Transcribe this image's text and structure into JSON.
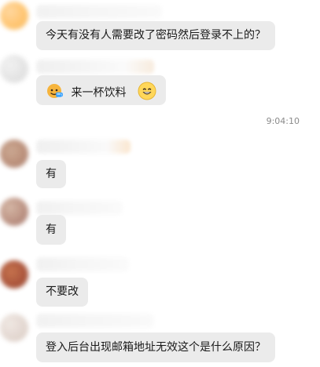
{
  "chat": {
    "messages": [
      {
        "text": "今天有没有人需要改了密码然后登录不上的？"
      },
      {
        "text": "来一杯饮料",
        "emoji_left": "drink-mascot-icon",
        "emoji_right": "grinning-face-icon"
      },
      {
        "time": "9:04:10"
      },
      {
        "text": "有"
      },
      {
        "text": "有"
      },
      {
        "text": "不要改"
      },
      {
        "text": "登入后台出现邮箱地址无效这个是什么原因？"
      }
    ]
  }
}
